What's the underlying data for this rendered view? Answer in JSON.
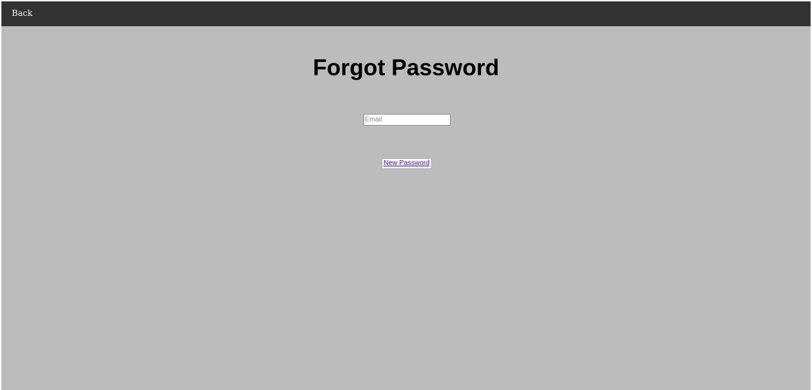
{
  "nav": {
    "back_label": "Back"
  },
  "main": {
    "title": "Forgot Password",
    "email_placeholder": "Email",
    "email_value": "",
    "submit_label": "New Password"
  },
  "colors": {
    "topbar": "#333333",
    "background": "#bcbcbc",
    "link": "#551a8b"
  }
}
